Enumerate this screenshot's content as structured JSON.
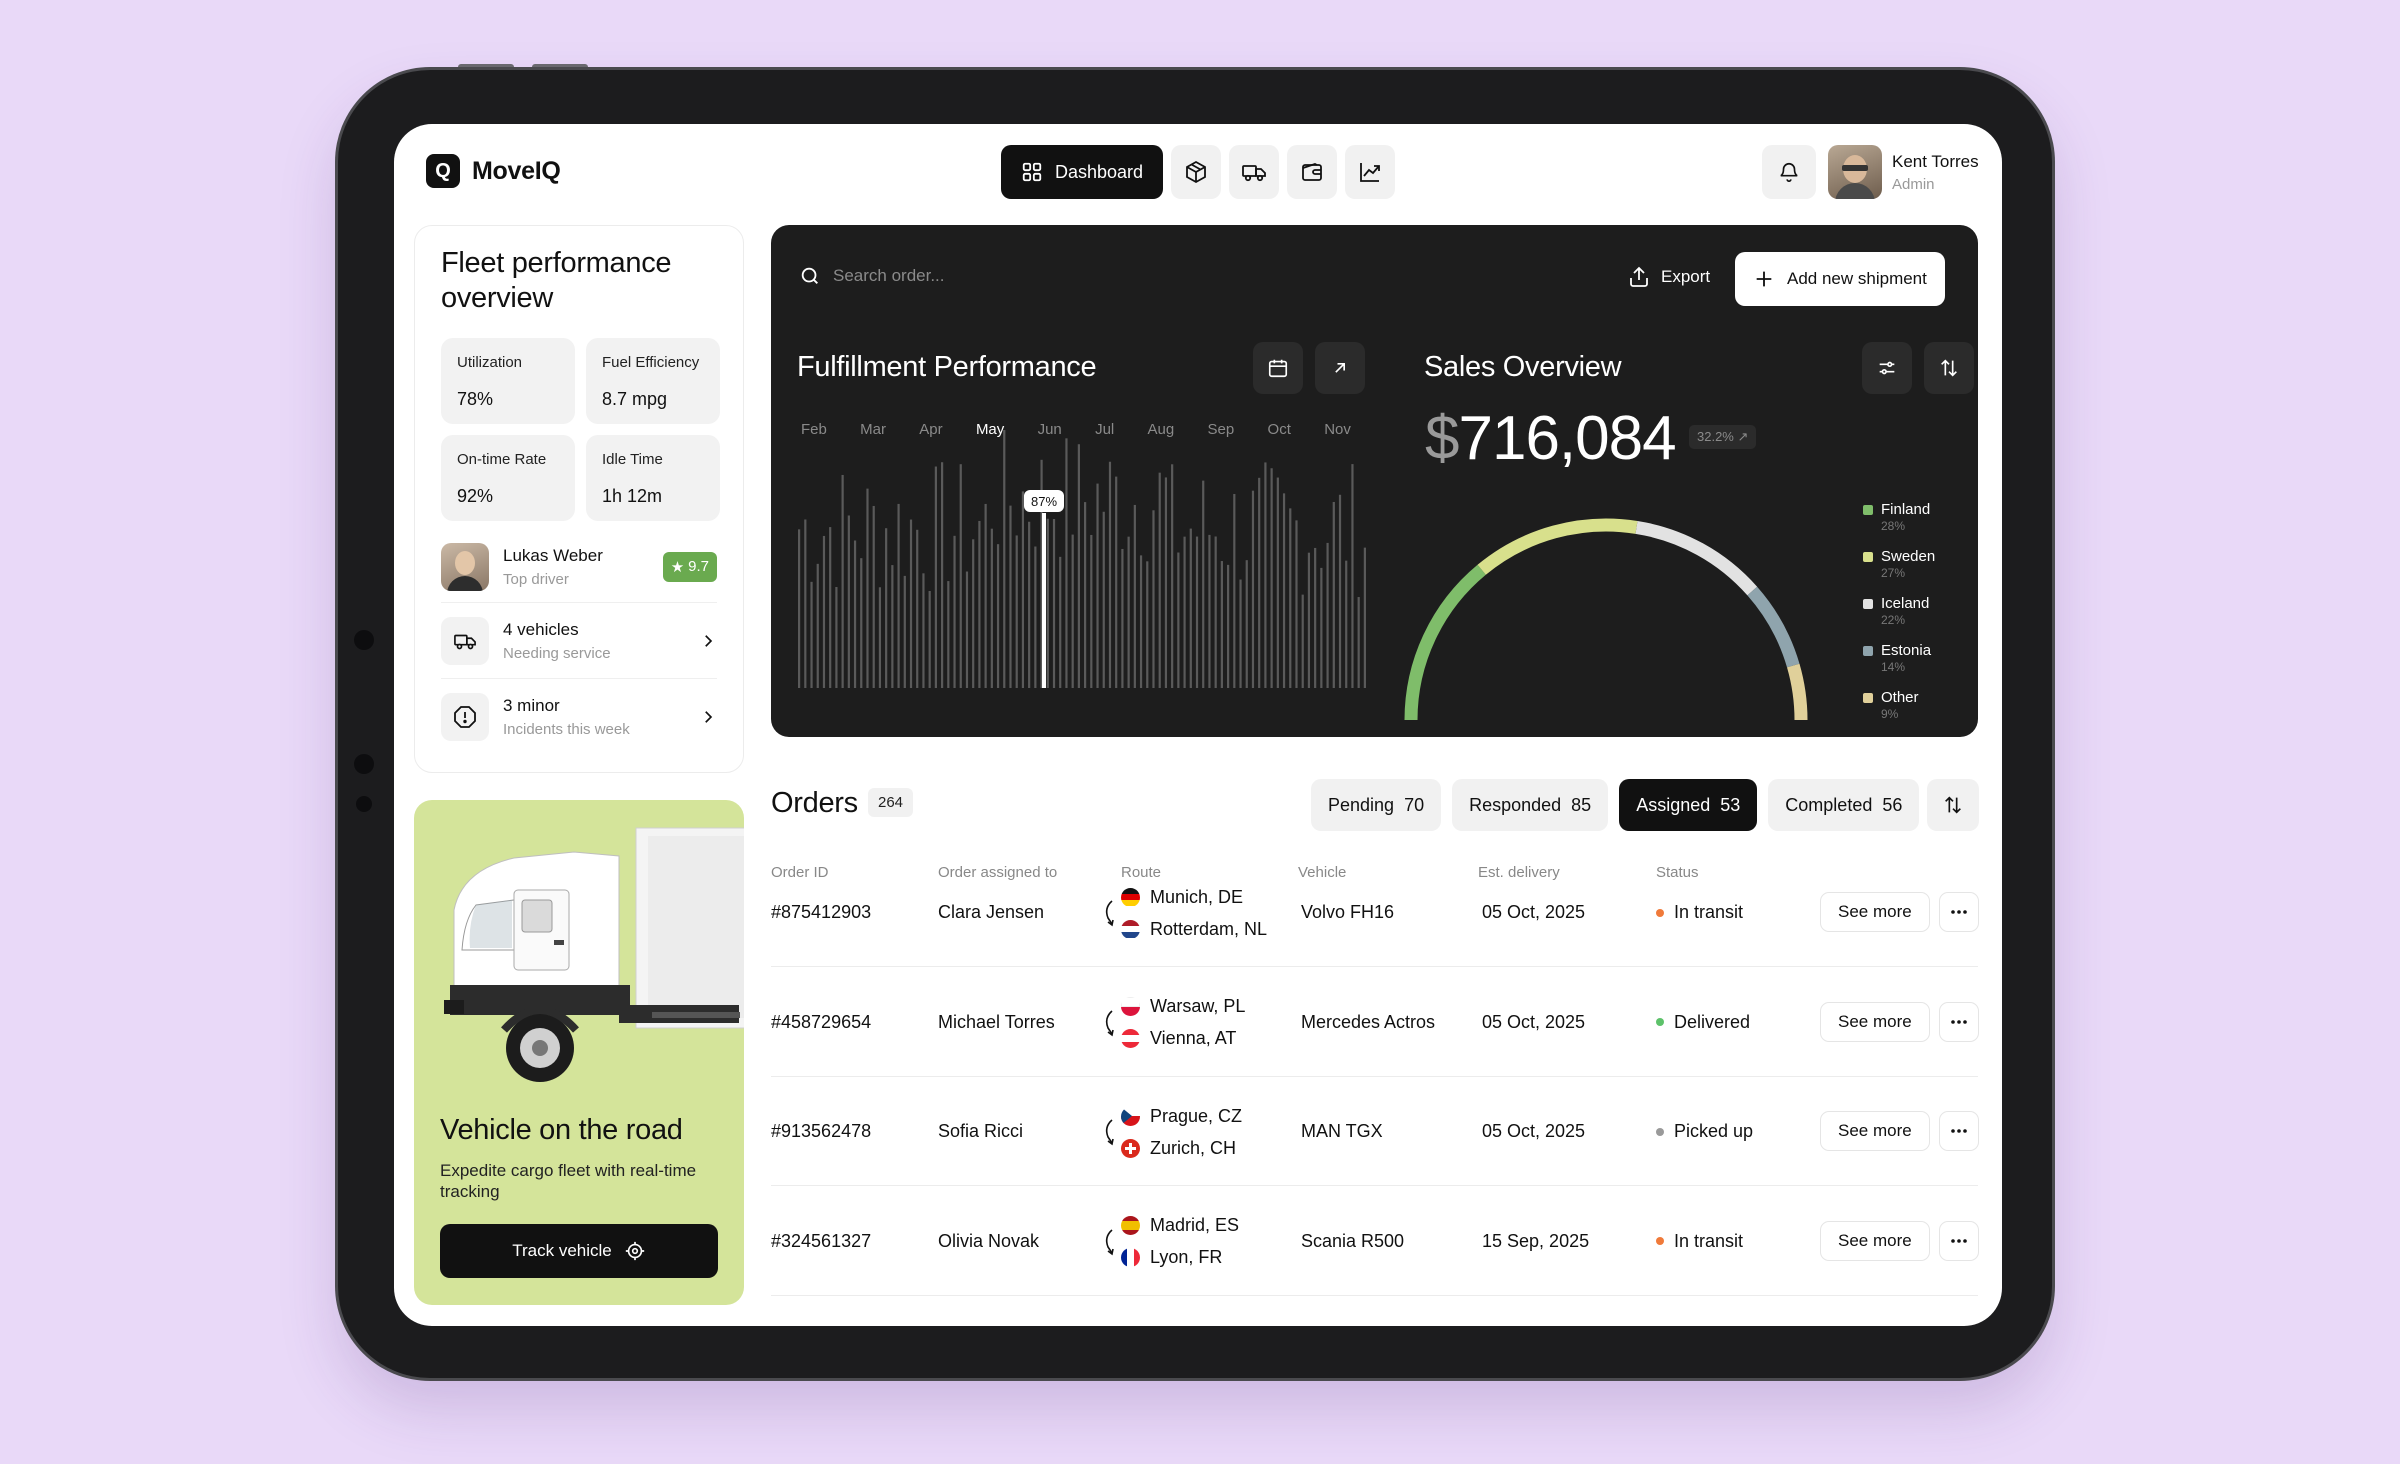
{
  "app": {
    "logo_letter": "Q",
    "name": "MoveIQ"
  },
  "nav": {
    "active_label": "Dashboard",
    "icons": [
      "package-icon",
      "truck-icon",
      "wallet-icon",
      "chart-icon"
    ]
  },
  "user": {
    "name": "Kent Torres",
    "role": "Admin"
  },
  "fleet": {
    "title": "Fleet performance overview",
    "stats": [
      {
        "label": "Utilization",
        "value": "78%"
      },
      {
        "label": "Fuel Efficiency",
        "value": "8.7 mpg"
      },
      {
        "label": "On-time Rate",
        "value": "92%"
      },
      {
        "label": "Idle Time",
        "value": "1h 12m"
      }
    ],
    "driver": {
      "name": "Lukas Weber",
      "role": "Top driver",
      "score": "9.7"
    },
    "vehicles": {
      "title": "4 vehicles",
      "sub": "Needing service"
    },
    "incidents": {
      "title": "3 minor",
      "sub": "Incidents this week"
    }
  },
  "promo": {
    "title": "Vehicle on the road",
    "subtitle": "Expedite cargo fleet with real-time tracking",
    "button": "Track vehicle"
  },
  "toolbar": {
    "search_placeholder": "Search order...",
    "export_label": "Export",
    "add_label": "Add new shipment"
  },
  "fulfillment": {
    "title": "Fulfillment Performance",
    "months": [
      "Feb",
      "Mar",
      "Apr",
      "May",
      "Jun",
      "Jul",
      "Aug",
      "Sep",
      "Oct",
      "Nov"
    ],
    "active_month": "May",
    "highlight_label": "87%"
  },
  "sales": {
    "title": "Sales Overview",
    "currency": "$",
    "amount": "716,084",
    "change": "32.2%",
    "legend": [
      {
        "name": "Finland",
        "value": "28%",
        "pct": 28,
        "color": "#7fbd6a"
      },
      {
        "name": "Sweden",
        "value": "27%",
        "pct": 27,
        "color": "#d8e08c"
      },
      {
        "name": "Iceland",
        "value": "22%",
        "pct": 22,
        "color": "#e2e2e2"
      },
      {
        "name": "Estonia",
        "value": "14%",
        "pct": 14,
        "color": "#8fa4ad"
      },
      {
        "name": "Other",
        "value": "9%",
        "pct": 9,
        "color": "#e0d09a"
      }
    ]
  },
  "orders": {
    "title": "Orders",
    "count": "264",
    "filters": [
      {
        "label": "Pending",
        "count": "70",
        "active": false
      },
      {
        "label": "Responded",
        "count": "85",
        "active": false
      },
      {
        "label": "Assigned",
        "count": "53",
        "active": true
      },
      {
        "label": "Completed",
        "count": "56",
        "active": false
      }
    ],
    "columns": [
      "Order ID",
      "Order assigned to",
      "Route",
      "Vehicle",
      "Est. delivery",
      "Status"
    ],
    "rows": [
      {
        "id": "#875412903",
        "assignee": "Clara Jensen",
        "from": "Munich, DE",
        "to": "Rotterdam, NL",
        "vehicle": "Volvo FH16",
        "delivery": "05 Oct, 2025",
        "status": "In transit",
        "status_color": "#f07a3a"
      },
      {
        "id": "#458729654",
        "assignee": "Michael Torres",
        "from": "Warsaw, PL",
        "to": "Vienna, AT",
        "vehicle": "Mercedes Actros",
        "delivery": "05 Oct, 2025",
        "status": "Delivered",
        "status_color": "#5dc26a"
      },
      {
        "id": "#913562478",
        "assignee": "Sofia Ricci",
        "from": "Prague, CZ",
        "to": "Zurich, CH",
        "vehicle": "MAN TGX",
        "delivery": "05 Oct, 2025",
        "status": "Picked up",
        "status_color": "#9a9a9a"
      },
      {
        "id": "#324561327",
        "assignee": "Olivia Novak",
        "from": "Madrid, ES",
        "to": "Lyon, FR",
        "vehicle": "Scania R500",
        "delivery": "15 Sep, 2025",
        "status": "In transit",
        "status_color": "#f07a3a"
      }
    ],
    "see_more_label": "See more"
  }
}
